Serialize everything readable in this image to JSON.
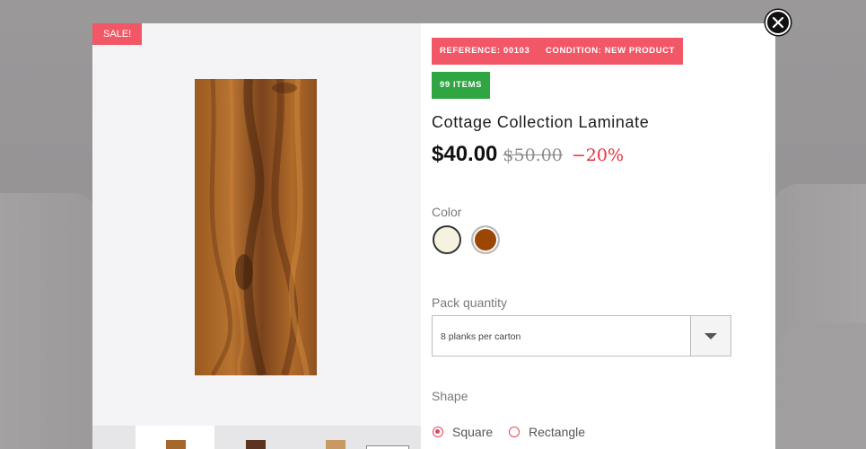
{
  "badge": {
    "sale": "SALE!"
  },
  "tags": {
    "reference": "REFERENCE: 00103",
    "condition": "CONDITION: NEW PRODUCT",
    "stock": "99 ITEMS"
  },
  "product": {
    "title": "Cottage Collection Laminate",
    "price": "$40.00",
    "old_price": "$50.00",
    "discount": "−20%"
  },
  "color": {
    "label": "Color",
    "options": [
      "#f5f3df",
      "#9c4604"
    ]
  },
  "pack_quantity": {
    "label": "Pack quantity",
    "selected": "8 planks per carton"
  },
  "shape": {
    "label": "Shape",
    "options": [
      "Square",
      "Rectangle"
    ],
    "selected": "Square"
  },
  "colors": {
    "accent": "#f25767",
    "stock_green": "#2fa642",
    "discount_red": "#e8303f"
  },
  "icons": [
    "close-icon",
    "chevron-down-icon"
  ]
}
